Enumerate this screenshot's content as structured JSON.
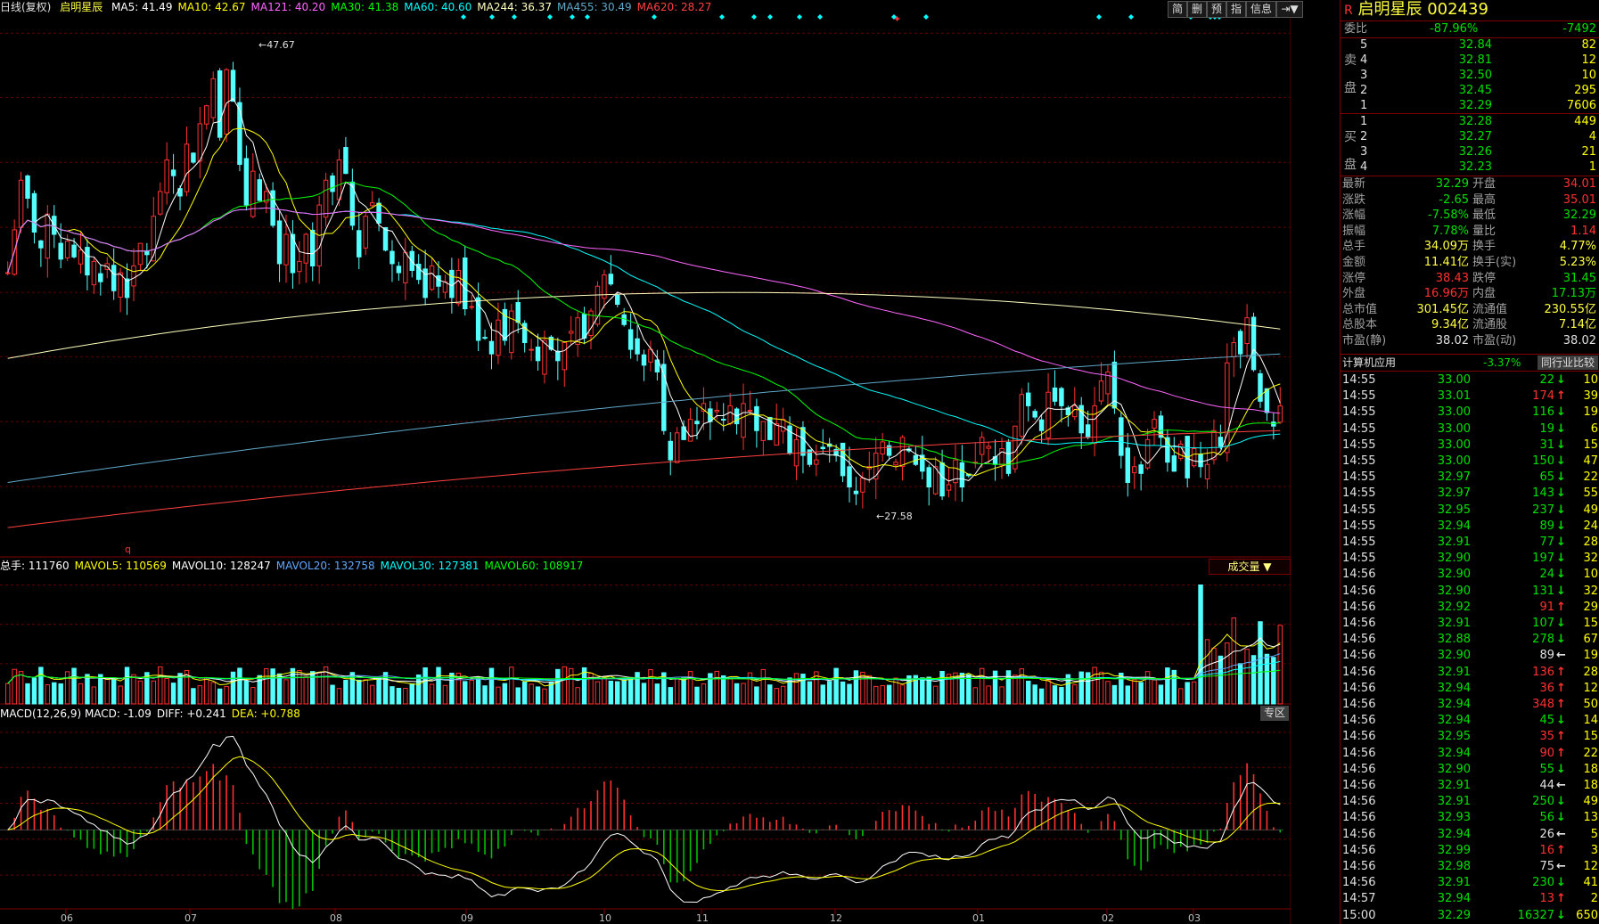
{
  "header": {
    "period": "日线(复权)",
    "name": "启明星辰",
    "ma_labels": [
      {
        "text": "MA5: 41.49",
        "color": "#ffffff"
      },
      {
        "text": "MA10: 42.67",
        "color": "#ffff00"
      },
      {
        "text": "MA121: 40.20",
        "color": "#ff66ff"
      },
      {
        "text": "MA30: 41.38",
        "color": "#00ff00"
      },
      {
        "text": "MA60: 40.60",
        "color": "#00ffff"
      },
      {
        "text": "MA244: 36.37",
        "color": "#ffffc0"
      },
      {
        "text": "MA455: 30.49",
        "color": "#5fa8c8"
      },
      {
        "text": "MA620: 28.27",
        "color": "#ff4040"
      }
    ]
  },
  "toolbar": {
    "buttons": [
      "简",
      "删",
      "预",
      "指",
      "信息",
      "⇥▼"
    ]
  },
  "vol_header": {
    "items": [
      {
        "text": "总手: 111760",
        "color": "#ffffff"
      },
      {
        "text": "MAVOL5: 110569",
        "color": "#ffff00"
      },
      {
        "text": "MAVOL10: 128247",
        "color": "#ffffff"
      },
      {
        "text": "MAVOL20: 132758",
        "color": "#5fa8ff"
      },
      {
        "text": "MAVOL30: 127381",
        "color": "#00ffff"
      },
      {
        "text": "MAVOL60: 108917",
        "color": "#00ff00"
      }
    ],
    "dropdown": "成交量 ▼"
  },
  "macd_header": {
    "items": [
      {
        "text": "MACD(12,26,9) MACD: -1.09",
        "color": "#ffffff"
      },
      {
        "text": "DIFF: +0.241",
        "color": "#ffffff"
      },
      {
        "text": "DEA: +0.788",
        "color": "#ffff00"
      }
    ],
    "zone_button": "专区"
  },
  "annotations": {
    "high": "47.67",
    "low": "27.58",
    "marker": "q"
  },
  "chart_data": [
    {
      "type": "candlestick",
      "title": "",
      "ylim": [
        25.6,
        49.5
      ],
      "yticks": [
        "48.82",
        "45.97",
        "43.09",
        "40.21",
        "37.33",
        "34.48",
        "31.60",
        "28.72"
      ],
      "xticks": [
        "06",
        "07",
        "08",
        "09",
        "10",
        "11",
        "12",
        "01",
        "02",
        "03"
      ],
      "close": [
        38.2,
        40.1,
        42.3,
        41.5,
        40.0,
        39.3,
        40.8,
        39.9,
        38.8,
        39.6,
        38.9,
        39.2,
        38.1,
        38.7,
        37.8,
        38.6,
        37.4,
        38.2,
        37.1,
        38.5,
        39.5,
        39.0,
        40.7,
        41.8,
        43.2,
        42.5,
        41.6,
        43.9,
        43.1,
        44.8,
        45.6,
        46.8,
        44.2,
        47.2,
        45.8,
        43.0,
        41.2,
        42.7,
        41.4,
        41.8,
        40.3,
        38.6,
        39.9,
        38.2,
        38.7,
        39.9,
        38.5,
        41.2,
        42.3,
        41.8,
        43.2,
        42.6,
        40.3,
        38.9,
        40.7,
        41.3,
        40.4,
        39.2,
        38.6,
        38.2,
        39.1,
        38.3,
        37.9,
        37.1,
        38.5,
        37.6,
        37.8,
        37.1,
        38.3,
        36.6,
        36.7,
        35.2,
        35.3,
        34.6,
        36.1,
        35.2,
        36.5,
        36.0,
        35.1,
        34.8,
        34.3,
        35.2,
        34.8,
        34.3,
        35.1,
        35.6,
        36.2,
        35.3,
        36.5,
        37.6,
        38.1,
        37.7,
        36.8,
        35.9,
        34.8,
        34.6,
        34.1,
        34.8,
        33.8,
        31.2,
        29.9,
        31.1,
        30.8,
        31.7,
        31.5,
        32.4,
        31.6,
        32.1,
        31.7,
        32.3,
        31.5,
        32.4,
        32.1,
        31.2,
        31.6,
        30.8,
        31.5,
        31.7,
        30.2,
        30.8,
        30.1,
        29.7,
        29.9,
        30.4,
        30.5,
        30.1,
        29.2,
        28.7,
        28.4,
        29.1,
        29.6,
        30.2,
        30.7,
        30.1,
        29.8,
        30.9,
        30.3,
        29.7,
        29.4,
        28.7,
        29.6,
        28.3,
        28.8,
        29.9,
        28.7,
        29.2,
        29.8,
        30.9,
        30.5,
        29.7,
        30.4,
        29.3,
        31.4,
        32.8,
        32.3,
        31.8,
        31.2,
        32.9,
        32.5,
        32.3,
        31.9,
        32.3,
        31.1,
        30.9,
        32.3,
        33.4,
        33.8,
        32.2,
        30.1,
        28.9,
        29.6,
        29.3,
        30.8,
        31.7,
        30.9,
        29.8,
        29.4,
        30.6,
        29.1,
        30.4,
        29.6,
        29.7,
        31.2,
        30.5,
        34.2,
        35.1,
        34.6,
        36.2,
        33.9,
        32.5,
        32.0,
        31.4,
        32.29
      ],
      "volume_ylim": [
        0,
        520000
      ],
      "volume_yticks": [
        "478760",
        "320274",
        "161788"
      ],
      "macd_ylim": [
        -1.35,
        1.85
      ],
      "macd_yticks": [
        "+1.67",
        "+1.07",
        "+0.456",
        "-0.158",
        "-0.772"
      ]
    }
  ],
  "side": {
    "title": "启明星辰 002439",
    "weibi": {
      "label": "委比",
      "pct": "-87.96%",
      "diff": "-7492"
    },
    "sell_label": [
      "卖",
      "盘"
    ],
    "buy_label": [
      "买",
      "盘"
    ],
    "asks": [
      [
        "5",
        "32.84",
        "82"
      ],
      [
        "4",
        "32.81",
        "12"
      ],
      [
        "3",
        "32.50",
        "10"
      ],
      [
        "2",
        "32.45",
        "295"
      ],
      [
        "1",
        "32.29",
        "7606"
      ]
    ],
    "bids": [
      [
        "1",
        "32.28",
        "449"
      ],
      [
        "2",
        "32.27",
        "4"
      ],
      [
        "3",
        "32.26",
        "21"
      ],
      [
        "4",
        "32.23",
        "1"
      ]
    ],
    "stats": [
      [
        "最新",
        "32.29",
        "开盘",
        "34.01",
        "g",
        "r"
      ],
      [
        "涨跌",
        "-2.65",
        "最高",
        "35.01",
        "g",
        "r"
      ],
      [
        "涨幅",
        "-7.58%",
        "最低",
        "32.29",
        "g",
        "g"
      ],
      [
        "振幅",
        "7.78%",
        "量比",
        "1.14",
        "g",
        "r"
      ],
      [
        "总手",
        "34.09万",
        "换手",
        "4.77%",
        "y",
        "y"
      ],
      [
        "金额",
        "11.41亿",
        "换手(实)",
        "5.23%",
        "y",
        "y"
      ],
      [
        "涨停",
        "38.43",
        "跌停",
        "31.45",
        "r",
        "g"
      ],
      [
        "外盘",
        "16.96万",
        "内盘",
        "17.13万",
        "r",
        "g"
      ],
      [
        "总市值",
        "301.45亿",
        "流通值",
        "230.55亿",
        "y",
        "y"
      ],
      [
        "总股本",
        "9.34亿",
        "流通股",
        "7.14亿",
        "y",
        "y"
      ],
      [
        "市盈(静)",
        "38.02",
        "市盈(动)",
        "38.02",
        "w",
        "w"
      ]
    ],
    "industry": {
      "name": "计算机应用",
      "pct": "-3.37%",
      "button": "同行业比较"
    },
    "ticks": [
      [
        "14:55",
        "33.00",
        "22",
        "↓",
        "10",
        "g"
      ],
      [
        "14:55",
        "33.01",
        "174",
        "↑",
        "39",
        "r"
      ],
      [
        "14:55",
        "33.00",
        "116",
        "↓",
        "19",
        "g"
      ],
      [
        "14:55",
        "33.00",
        "19",
        "↓",
        "6",
        "g"
      ],
      [
        "14:55",
        "33.00",
        "31",
        "↓",
        "15",
        "g"
      ],
      [
        "14:55",
        "33.00",
        "150",
        "↓",
        "47",
        "g"
      ],
      [
        "14:55",
        "32.97",
        "65",
        "↓",
        "22",
        "g"
      ],
      [
        "14:55",
        "32.97",
        "143",
        "↓",
        "55",
        "g"
      ],
      [
        "14:55",
        "32.95",
        "237",
        "↓",
        "49",
        "g"
      ],
      [
        "14:55",
        "32.94",
        "89",
        "↓",
        "24",
        "g"
      ],
      [
        "14:55",
        "32.91",
        "77",
        "↓",
        "28",
        "g"
      ],
      [
        "14:55",
        "32.90",
        "197",
        "↓",
        "32",
        "g"
      ],
      [
        "14:56",
        "32.90",
        "24",
        "↓",
        "10",
        "g"
      ],
      [
        "14:56",
        "32.90",
        "131",
        "↓",
        "32",
        "g"
      ],
      [
        "14:56",
        "32.92",
        "91",
        "↑",
        "29",
        "r"
      ],
      [
        "14:56",
        "32.91",
        "107",
        "↓",
        "15",
        "g"
      ],
      [
        "14:56",
        "32.88",
        "278",
        "↓",
        "67",
        "g"
      ],
      [
        "14:56",
        "32.90",
        "89",
        "←",
        "19",
        "w"
      ],
      [
        "14:56",
        "32.91",
        "136",
        "↑",
        "28",
        "r"
      ],
      [
        "14:56",
        "32.94",
        "36",
        "↑",
        "12",
        "r"
      ],
      [
        "14:56",
        "32.94",
        "348",
        "↑",
        "50",
        "r"
      ],
      [
        "14:56",
        "32.94",
        "45",
        "↓",
        "14",
        "g"
      ],
      [
        "14:56",
        "32.95",
        "35",
        "↑",
        "15",
        "r"
      ],
      [
        "14:56",
        "32.94",
        "90",
        "↑",
        "22",
        "r"
      ],
      [
        "14:56",
        "32.90",
        "55",
        "↓",
        "18",
        "g"
      ],
      [
        "14:56",
        "32.91",
        "44",
        "←",
        "18",
        "w"
      ],
      [
        "14:56",
        "32.91",
        "250",
        "↓",
        "49",
        "g"
      ],
      [
        "14:56",
        "32.93",
        "56",
        "↓",
        "13",
        "g"
      ],
      [
        "14:56",
        "32.94",
        "26",
        "←",
        "5",
        "w"
      ],
      [
        "14:56",
        "32.99",
        "16",
        "↑",
        "3",
        "r"
      ],
      [
        "14:56",
        "32.98",
        "75",
        "←",
        "12",
        "w"
      ],
      [
        "14:56",
        "32.91",
        "230",
        "↓",
        "41",
        "g"
      ],
      [
        "14:57",
        "32.94",
        "13",
        "↑",
        "2",
        "r"
      ],
      [
        "15:00",
        "32.29",
        "16327",
        "↓",
        "650",
        "g"
      ]
    ]
  }
}
